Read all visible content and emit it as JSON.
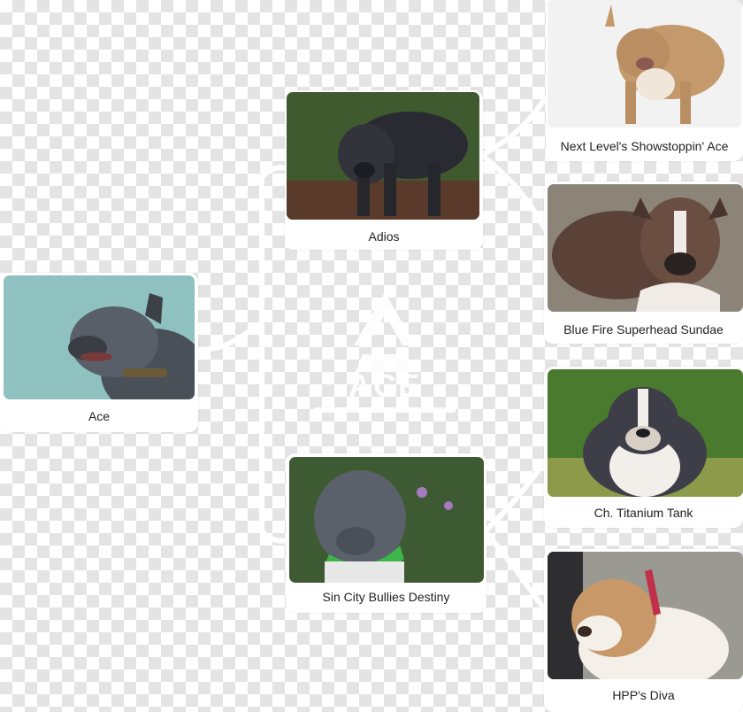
{
  "pedigree": {
    "subject": {
      "name": "Ace",
      "photo_icon": "blue-pitbull-profile"
    },
    "sire": {
      "name": "Adios",
      "photo_icon": "dark-bully-standing"
    },
    "dam": {
      "name": "Sin City Bullies Destiny",
      "photo_icon": "blue-bully-green-collar"
    },
    "sire_sire": {
      "name": "Next Level's Showstoppin' Ace",
      "photo_icon": "fawn-bully-snow"
    },
    "sire_dam": {
      "name": "Blue Fire Superhead Sundae",
      "photo_icon": "brindle-bully-front"
    },
    "dam_sire": {
      "name": "Ch. Titanium Tank",
      "photo_icon": "tricolor-bully-grass"
    },
    "dam_dam": {
      "name": "HPP's Diva",
      "photo_icon": "fawn-white-bully-red-collar"
    }
  },
  "watermark": {
    "logo_icon": "ace-kennel-logo"
  },
  "colors": {
    "connector": "#ffffff",
    "card": "#ffffff",
    "checker": "#e4e4e4"
  }
}
